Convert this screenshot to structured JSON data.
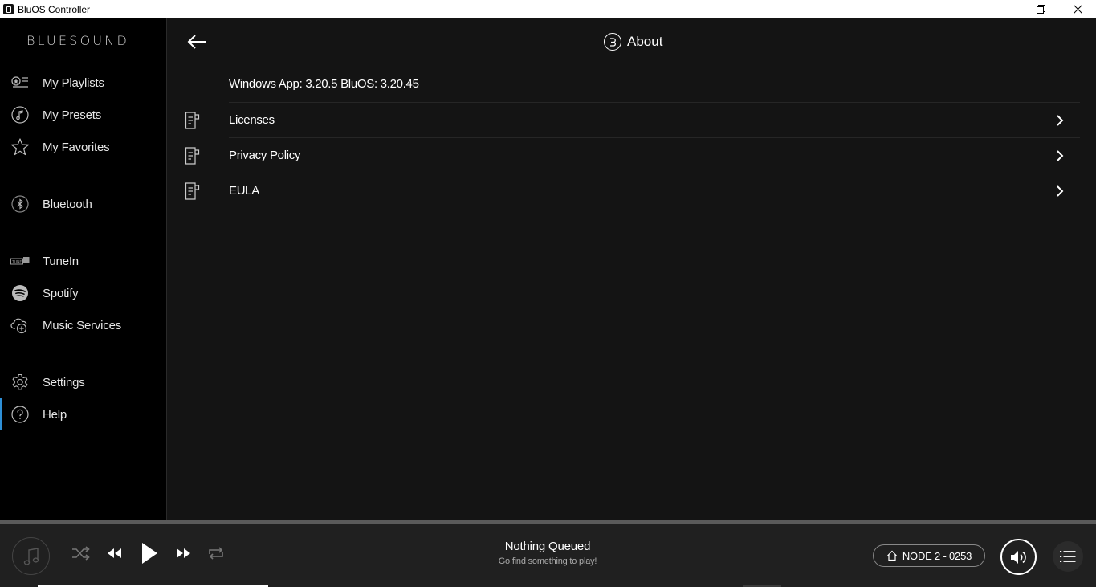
{
  "window": {
    "title": "BluOS Controller"
  },
  "sidebar": {
    "logo": "BLUESOUND",
    "items": [
      {
        "label": "My Playlists",
        "icon": "playlist-icon"
      },
      {
        "label": "My Presets",
        "icon": "music-note-circle-icon"
      },
      {
        "label": "My Favorites",
        "icon": "star-icon"
      },
      {
        "label": "Bluetooth",
        "icon": "bluetooth-icon"
      },
      {
        "label": "TuneIn",
        "icon": "tunein-icon"
      },
      {
        "label": "Spotify",
        "icon": "spotify-icon"
      },
      {
        "label": "Music Services",
        "icon": "cloud-plus-icon"
      },
      {
        "label": "Settings",
        "icon": "gear-icon"
      },
      {
        "label": "Help",
        "icon": "question-icon",
        "active": true
      }
    ]
  },
  "main": {
    "title": "About",
    "version_text": "Windows App: 3.20.5 BluOS: 3.20.45",
    "rows": [
      {
        "label": "Licenses"
      },
      {
        "label": "Privacy Policy"
      },
      {
        "label": "EULA"
      }
    ]
  },
  "player": {
    "now_title": "Nothing Queued",
    "now_subtitle": "Go find something to play!",
    "node_label": "NODE 2 - 0253",
    "progress": 0.21
  },
  "colors": {
    "accent": "#2e8fd6",
    "sidebar_bg": "#000000",
    "main_bg": "#141414",
    "player_bg": "#202020"
  }
}
